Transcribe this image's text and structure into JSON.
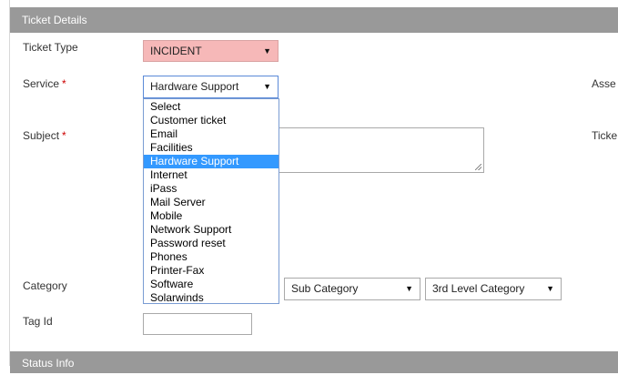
{
  "section_headers": {
    "ticket_details": "Ticket Details",
    "status_info": "Status Info"
  },
  "labels": {
    "ticket_type": "Ticket Type",
    "service": "Service",
    "subject": "Subject",
    "category": "Category",
    "tag_id": "Tag Id",
    "asset_truncated": "Asse",
    "ticket_truncated": "Ticke",
    "required_marker": "*"
  },
  "fields": {
    "ticket_type_value": "INCIDENT",
    "service_value": "Hardware Support",
    "sub_category_value": "Sub Category",
    "third_level_category_value": "3rd Level Category",
    "subject_value": "",
    "tag_id_value": ""
  },
  "icons": {
    "dropdown_arrow": "▼"
  },
  "service_options": [
    {
      "label": "Select",
      "selected": false
    },
    {
      "label": "Customer ticket",
      "selected": false
    },
    {
      "label": "Email",
      "selected": false
    },
    {
      "label": "Facilities",
      "selected": false
    },
    {
      "label": "Hardware Support",
      "selected": true
    },
    {
      "label": "Internet",
      "selected": false
    },
    {
      "label": "iPass",
      "selected": false
    },
    {
      "label": "Mail Server",
      "selected": false
    },
    {
      "label": "Mobile",
      "selected": false
    },
    {
      "label": "Network Support",
      "selected": false
    },
    {
      "label": "Password reset",
      "selected": false
    },
    {
      "label": "Phones",
      "selected": false
    },
    {
      "label": "Printer-Fax",
      "selected": false
    },
    {
      "label": "Software",
      "selected": false
    },
    {
      "label": "Solarwinds",
      "selected": false
    }
  ],
  "colors": {
    "header_bg": "#999999",
    "ticket_type_bg": "#f6b8b8",
    "selected_option_bg": "#3399ff",
    "required_marker": "#cc0000"
  }
}
